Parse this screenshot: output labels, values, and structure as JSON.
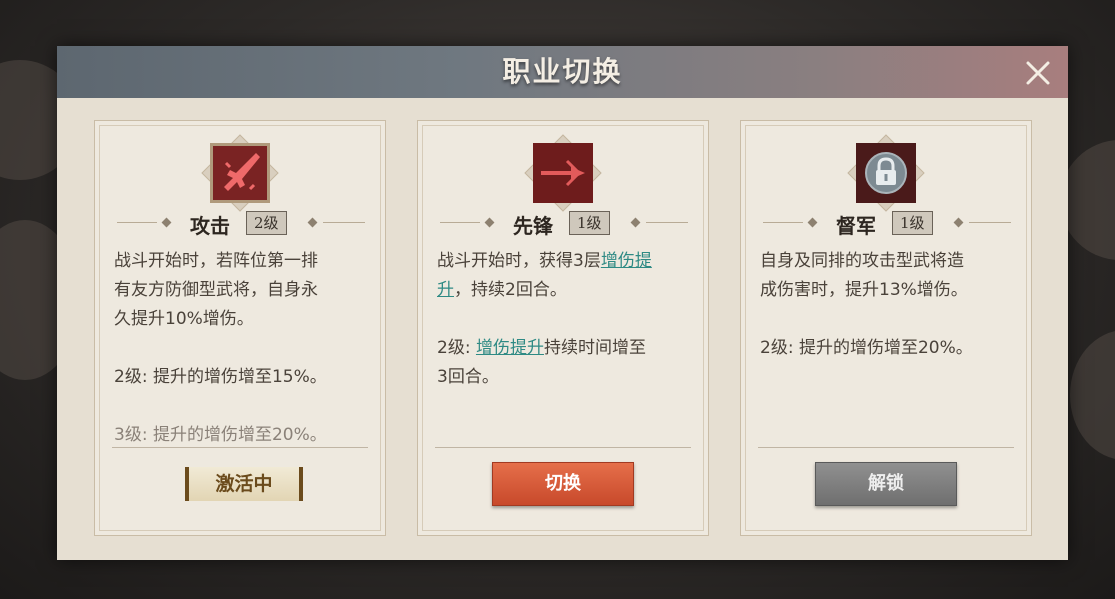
{
  "dialog": {
    "title": "职业切换",
    "close_icon": "close-icon"
  },
  "cards": [
    {
      "icon": "sword-icon",
      "name": "攻击",
      "level": "2级",
      "desc_main": [
        "战斗开始时，若阵位第一排",
        "有友方防御型武将，自身永",
        "久提升10%增伤。"
      ],
      "desc_lv2": "2级: 提升的增伤增至15%。",
      "desc_lv3": "3级: 提升的增伤增至20%。",
      "status": "激活中"
    },
    {
      "icon": "dagger-icon",
      "name": "先锋",
      "level": "1级",
      "desc_main_prefix": "战斗开始时，获得3层",
      "desc_link1": "增伤提",
      "desc_link1b": "升",
      "desc_main_suffix": "，持续2回合。",
      "desc_lv2_prefix": "2级: ",
      "desc_lv2_link": "增伤提升",
      "desc_lv2_suffix": "持续时间增至",
      "desc_lv2_line2": "3回合。",
      "button": "切换"
    },
    {
      "icon": "lock-icon",
      "name": "督军",
      "level": "1级",
      "desc_main": [
        "自身及同排的攻击型武将造",
        "成伤害时，提升13%增伤。"
      ],
      "desc_lv2": "2级: 提升的增伤增至20%。",
      "button": "解锁"
    }
  ],
  "colors": {
    "accent_red": "#c8492b",
    "link_teal": "#2e8a84",
    "active_brown": "#6b4b1c"
  }
}
